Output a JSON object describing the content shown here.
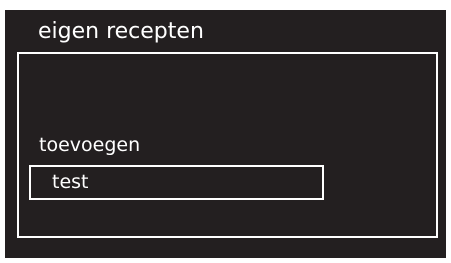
{
  "screen": {
    "title": "eigen recepten",
    "background_color": "#231f20",
    "foreground_color": "#ffffff"
  },
  "menu": {
    "items": [
      {
        "label": "toevoegen",
        "selected": false
      },
      {
        "label": "test",
        "selected": true
      }
    ]
  }
}
